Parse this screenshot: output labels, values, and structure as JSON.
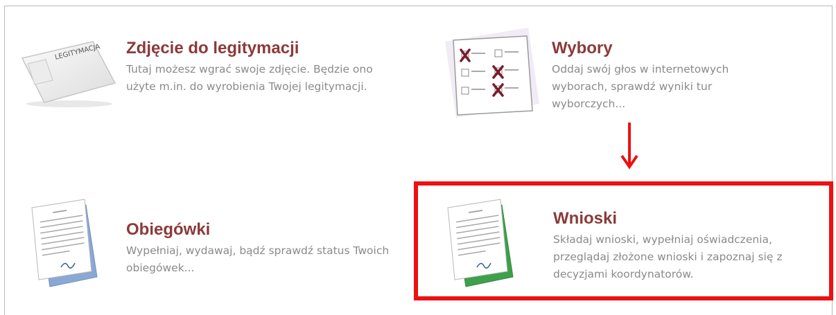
{
  "tiles": [
    {
      "id": "legitymacja",
      "title": "Zdjęcie do legitymacji",
      "description": "Tutaj możesz wgrać swoje zdjęcie. Będzie ono użyte m.in. do wyrobienia Twojej legitymacji.",
      "icon": "id-card-icon",
      "icon_label": "LEGITYMACJA"
    },
    {
      "id": "wybory",
      "title": "Wybory",
      "description": "Oddaj swój głos w internetowych wyborach, sprawdź wyniki tur wyborczych...",
      "icon": "ballot-icon"
    },
    {
      "id": "obiegowki",
      "title": "Obiegówki",
      "description": "Wypełniaj, wydawaj, bądź sprawdź status Twoich obiegówek...",
      "icon": "document-icon"
    },
    {
      "id": "wnioski",
      "title": "Wnioski",
      "description": "Składaj wnioski, wypełniaj oświadczenia, przeglądaj złożone wnioski i zapoznaj się z decyzjami koordynatorów.",
      "icon": "application-document-icon"
    }
  ],
  "annotation": {
    "highlight_color": "#ee1111",
    "arrow_icon": "arrow-down-icon"
  },
  "colors": {
    "title": "#8b3a3a",
    "description": "#8a8a8a",
    "border": "#b8b8b8"
  }
}
